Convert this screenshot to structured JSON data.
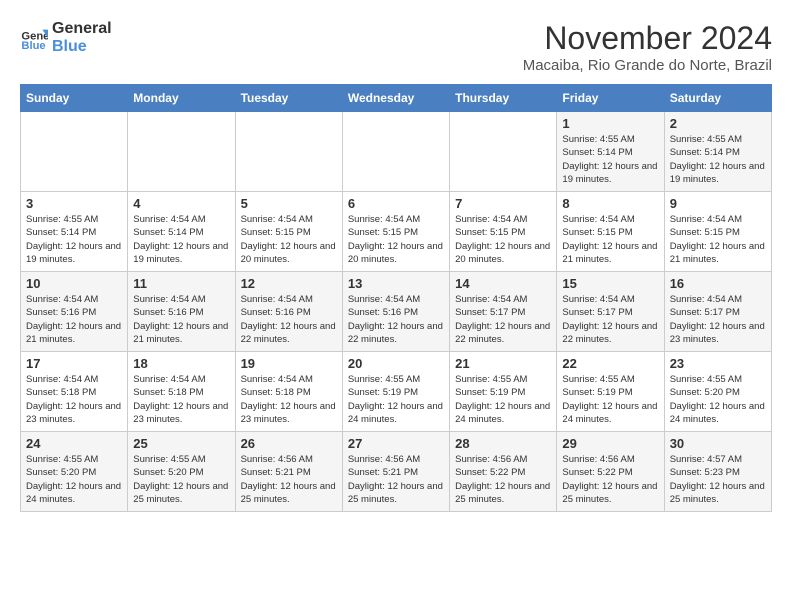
{
  "logo": {
    "line1": "General",
    "line2": "Blue"
  },
  "title": "November 2024",
  "location": "Macaiba, Rio Grande do Norte, Brazil",
  "weekdays": [
    "Sunday",
    "Monday",
    "Tuesday",
    "Wednesday",
    "Thursday",
    "Friday",
    "Saturday"
  ],
  "weeks": [
    [
      {
        "day": "",
        "info": ""
      },
      {
        "day": "",
        "info": ""
      },
      {
        "day": "",
        "info": ""
      },
      {
        "day": "",
        "info": ""
      },
      {
        "day": "",
        "info": ""
      },
      {
        "day": "1",
        "info": "Sunrise: 4:55 AM\nSunset: 5:14 PM\nDaylight: 12 hours and 19 minutes."
      },
      {
        "day": "2",
        "info": "Sunrise: 4:55 AM\nSunset: 5:14 PM\nDaylight: 12 hours and 19 minutes."
      }
    ],
    [
      {
        "day": "3",
        "info": "Sunrise: 4:55 AM\nSunset: 5:14 PM\nDaylight: 12 hours and 19 minutes."
      },
      {
        "day": "4",
        "info": "Sunrise: 4:54 AM\nSunset: 5:14 PM\nDaylight: 12 hours and 19 minutes."
      },
      {
        "day": "5",
        "info": "Sunrise: 4:54 AM\nSunset: 5:15 PM\nDaylight: 12 hours and 20 minutes."
      },
      {
        "day": "6",
        "info": "Sunrise: 4:54 AM\nSunset: 5:15 PM\nDaylight: 12 hours and 20 minutes."
      },
      {
        "day": "7",
        "info": "Sunrise: 4:54 AM\nSunset: 5:15 PM\nDaylight: 12 hours and 20 minutes."
      },
      {
        "day": "8",
        "info": "Sunrise: 4:54 AM\nSunset: 5:15 PM\nDaylight: 12 hours and 21 minutes."
      },
      {
        "day": "9",
        "info": "Sunrise: 4:54 AM\nSunset: 5:15 PM\nDaylight: 12 hours and 21 minutes."
      }
    ],
    [
      {
        "day": "10",
        "info": "Sunrise: 4:54 AM\nSunset: 5:16 PM\nDaylight: 12 hours and 21 minutes."
      },
      {
        "day": "11",
        "info": "Sunrise: 4:54 AM\nSunset: 5:16 PM\nDaylight: 12 hours and 21 minutes."
      },
      {
        "day": "12",
        "info": "Sunrise: 4:54 AM\nSunset: 5:16 PM\nDaylight: 12 hours and 22 minutes."
      },
      {
        "day": "13",
        "info": "Sunrise: 4:54 AM\nSunset: 5:16 PM\nDaylight: 12 hours and 22 minutes."
      },
      {
        "day": "14",
        "info": "Sunrise: 4:54 AM\nSunset: 5:17 PM\nDaylight: 12 hours and 22 minutes."
      },
      {
        "day": "15",
        "info": "Sunrise: 4:54 AM\nSunset: 5:17 PM\nDaylight: 12 hours and 22 minutes."
      },
      {
        "day": "16",
        "info": "Sunrise: 4:54 AM\nSunset: 5:17 PM\nDaylight: 12 hours and 23 minutes."
      }
    ],
    [
      {
        "day": "17",
        "info": "Sunrise: 4:54 AM\nSunset: 5:18 PM\nDaylight: 12 hours and 23 minutes."
      },
      {
        "day": "18",
        "info": "Sunrise: 4:54 AM\nSunset: 5:18 PM\nDaylight: 12 hours and 23 minutes."
      },
      {
        "day": "19",
        "info": "Sunrise: 4:54 AM\nSunset: 5:18 PM\nDaylight: 12 hours and 23 minutes."
      },
      {
        "day": "20",
        "info": "Sunrise: 4:55 AM\nSunset: 5:19 PM\nDaylight: 12 hours and 24 minutes."
      },
      {
        "day": "21",
        "info": "Sunrise: 4:55 AM\nSunset: 5:19 PM\nDaylight: 12 hours and 24 minutes."
      },
      {
        "day": "22",
        "info": "Sunrise: 4:55 AM\nSunset: 5:19 PM\nDaylight: 12 hours and 24 minutes."
      },
      {
        "day": "23",
        "info": "Sunrise: 4:55 AM\nSunset: 5:20 PM\nDaylight: 12 hours and 24 minutes."
      }
    ],
    [
      {
        "day": "24",
        "info": "Sunrise: 4:55 AM\nSunset: 5:20 PM\nDaylight: 12 hours and 24 minutes."
      },
      {
        "day": "25",
        "info": "Sunrise: 4:55 AM\nSunset: 5:20 PM\nDaylight: 12 hours and 25 minutes."
      },
      {
        "day": "26",
        "info": "Sunrise: 4:56 AM\nSunset: 5:21 PM\nDaylight: 12 hours and 25 minutes."
      },
      {
        "day": "27",
        "info": "Sunrise: 4:56 AM\nSunset: 5:21 PM\nDaylight: 12 hours and 25 minutes."
      },
      {
        "day": "28",
        "info": "Sunrise: 4:56 AM\nSunset: 5:22 PM\nDaylight: 12 hours and 25 minutes."
      },
      {
        "day": "29",
        "info": "Sunrise: 4:56 AM\nSunset: 5:22 PM\nDaylight: 12 hours and 25 minutes."
      },
      {
        "day": "30",
        "info": "Sunrise: 4:57 AM\nSunset: 5:23 PM\nDaylight: 12 hours and 25 minutes."
      }
    ]
  ]
}
